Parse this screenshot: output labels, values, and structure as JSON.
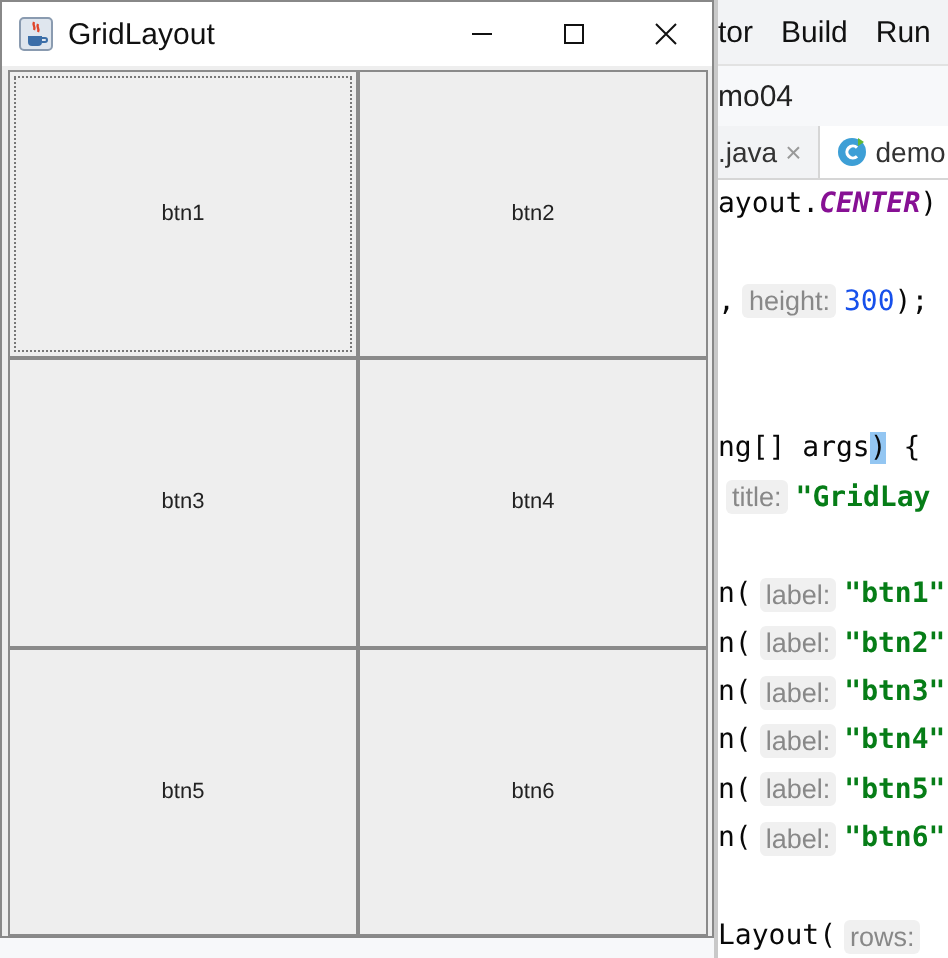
{
  "window": {
    "title": "GridLayout",
    "buttons": [
      {
        "label": "btn1",
        "focused": true
      },
      {
        "label": "btn2",
        "focused": false
      },
      {
        "label": "btn3",
        "focused": false
      },
      {
        "label": "btn4",
        "focused": false
      },
      {
        "label": "btn5",
        "focused": false
      },
      {
        "label": "btn6",
        "focused": false
      }
    ]
  },
  "ide": {
    "menu": [
      "tor",
      "Build",
      "Run"
    ],
    "breadcrumb": "mo04",
    "tabs": [
      {
        "label": ".java",
        "selected": false,
        "close_glyph": "×"
      },
      {
        "label": "demo",
        "selected": true
      }
    ],
    "code_lines": [
      {
        "kind": "code",
        "segments": [
          {
            "kind": "plain",
            "text": "ayout."
          },
          {
            "kind": "constant",
            "text": "CENTER"
          },
          {
            "kind": "plain",
            "text": ")"
          }
        ]
      },
      {
        "kind": "blank"
      },
      {
        "kind": "code",
        "segments": [
          {
            "kind": "plain",
            "text": ","
          },
          {
            "kind": "hint",
            "text": "height:"
          },
          {
            "kind": "number",
            "text": "300"
          },
          {
            "kind": "plain",
            "text": ");"
          }
        ]
      },
      {
        "kind": "blank"
      },
      {
        "kind": "blank"
      },
      {
        "kind": "code",
        "segments": [
          {
            "kind": "plain",
            "text": "ng[] args"
          },
          {
            "kind": "match",
            "text": ")"
          },
          {
            "kind": "plain",
            "text": " {"
          }
        ]
      },
      {
        "kind": "code",
        "segments": [
          {
            "kind": "hint",
            "text": "title:"
          },
          {
            "kind": "string",
            "text": "\"GridLay"
          }
        ]
      },
      {
        "kind": "blank"
      },
      {
        "kind": "code",
        "segments": [
          {
            "kind": "plain",
            "text": "n("
          },
          {
            "kind": "hint",
            "text": "label:"
          },
          {
            "kind": "string",
            "text": "\"btn1\""
          }
        ]
      },
      {
        "kind": "code",
        "segments": [
          {
            "kind": "plain",
            "text": "n("
          },
          {
            "kind": "hint",
            "text": "label:"
          },
          {
            "kind": "string",
            "text": "\"btn2\""
          }
        ]
      },
      {
        "kind": "code",
        "segments": [
          {
            "kind": "plain",
            "text": "n("
          },
          {
            "kind": "hint",
            "text": "label:"
          },
          {
            "kind": "string",
            "text": "\"btn3\""
          }
        ]
      },
      {
        "kind": "code",
        "segments": [
          {
            "kind": "plain",
            "text": "n("
          },
          {
            "kind": "hint",
            "text": "label:"
          },
          {
            "kind": "string",
            "text": "\"btn4\""
          }
        ]
      },
      {
        "kind": "code",
        "segments": [
          {
            "kind": "plain",
            "text": "n("
          },
          {
            "kind": "hint",
            "text": "label:"
          },
          {
            "kind": "string",
            "text": "\"btn5\""
          }
        ]
      },
      {
        "kind": "code",
        "segments": [
          {
            "kind": "plain",
            "text": "n("
          },
          {
            "kind": "hint",
            "text": "label:"
          },
          {
            "kind": "string",
            "text": "\"btn6\""
          }
        ]
      },
      {
        "kind": "blank"
      },
      {
        "kind": "code",
        "segments": [
          {
            "kind": "plain",
            "text": "Layout("
          },
          {
            "kind": "hint",
            "text": "rows:"
          }
        ]
      }
    ]
  }
}
